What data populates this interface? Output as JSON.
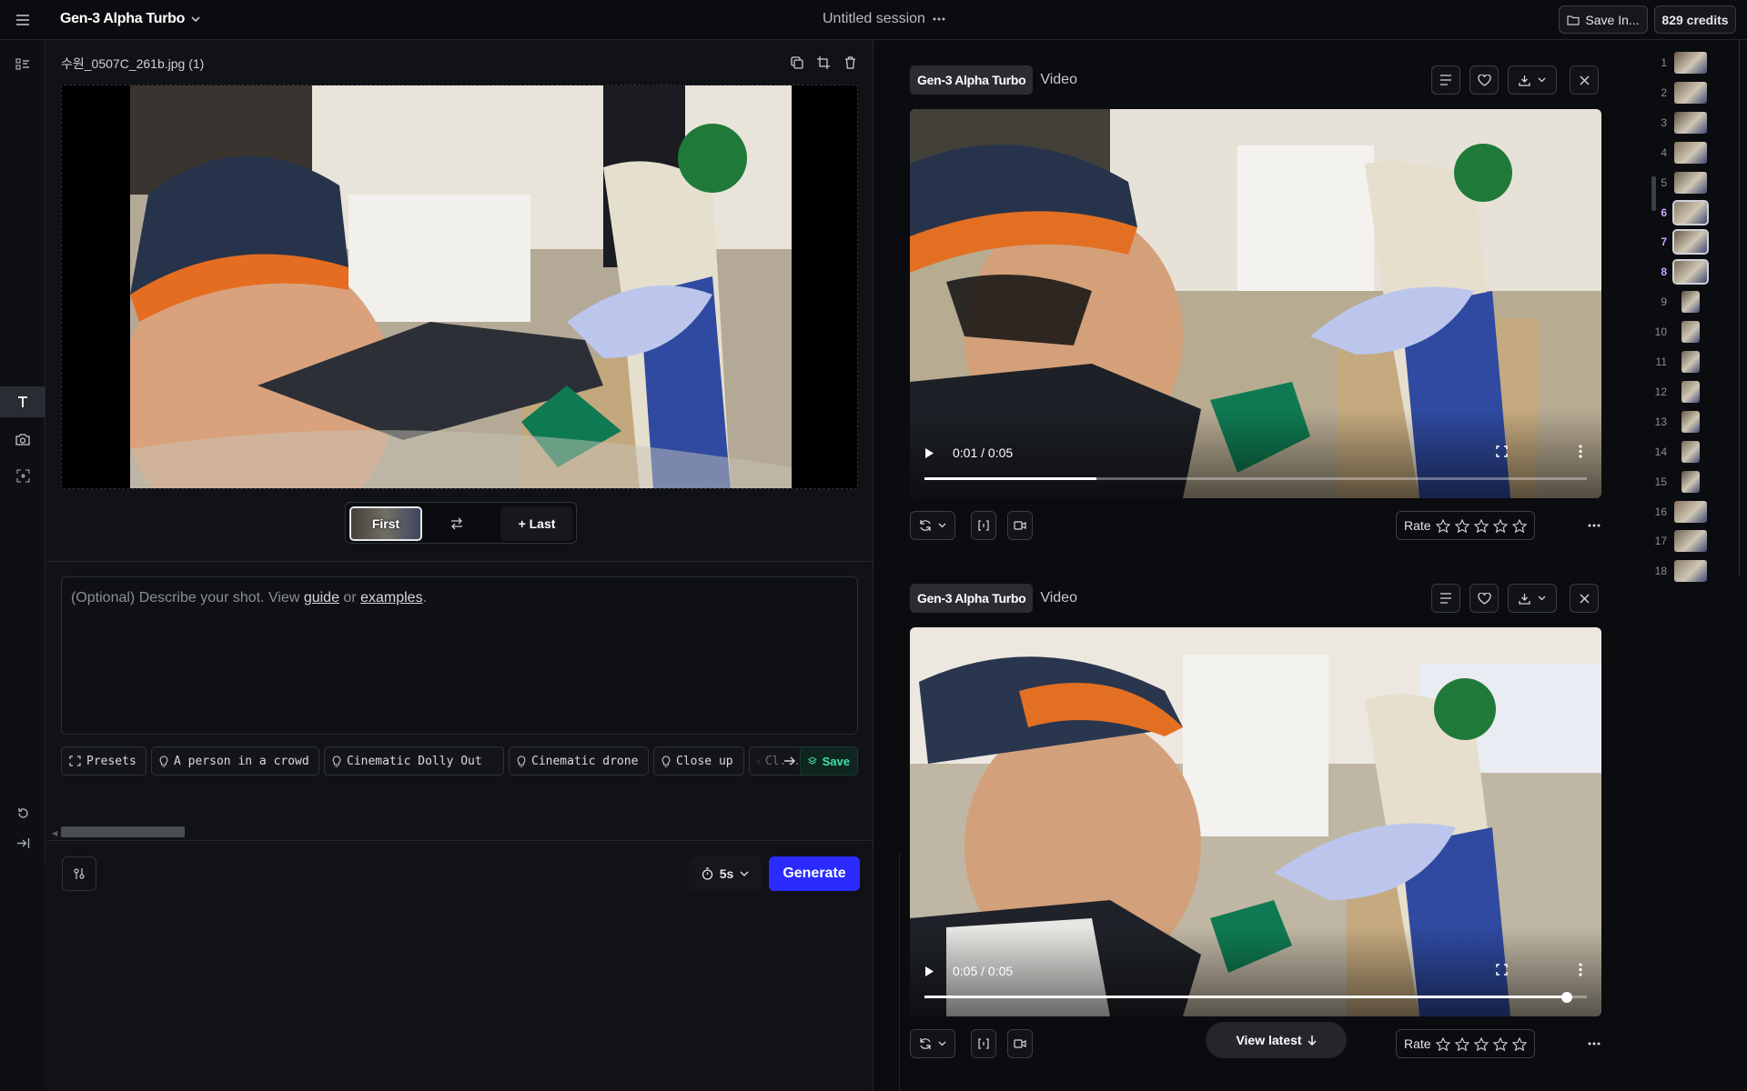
{
  "topbar": {
    "app_name": "Gen-3 Alpha Turbo",
    "session_title": "Untitled session",
    "save_label": "Save In...",
    "credits": "829 credits"
  },
  "left": {
    "file_name": "수원_0507C_261b.jpg (1)",
    "first_label": "First",
    "last_label": "+ Last",
    "prompt_placeholder_prefix": "(Optional) Describe your shot. View ",
    "prompt_link_guide": "guide",
    "prompt_or": " or ",
    "prompt_link_examples": "examples",
    "prompt_period": ".",
    "chips": [
      "Presets",
      "A person in a crowd",
      "Cinematic Dolly Out",
      "Cinematic drone",
      "Close up",
      "Cl..."
    ],
    "chip_save": "Save",
    "duration": "5s",
    "generate_label": "Generate"
  },
  "results": [
    {
      "model": "Gen-3 Alpha Turbo",
      "kind": "Video",
      "time": "0:01 / 0:05",
      "progress": 0.26,
      "rate_label": "Rate"
    },
    {
      "model": "Gen-3 Alpha Turbo",
      "kind": "Video",
      "time": "0:05 / 0:05",
      "progress": 0.97,
      "rate_label": "Rate"
    }
  ],
  "view_latest": "View latest",
  "strip": {
    "numbers": [
      "1",
      "2",
      "3",
      "4",
      "5",
      "6",
      "7",
      "8",
      "9",
      "10",
      "11",
      "12",
      "13",
      "14",
      "15",
      "16",
      "17",
      "18"
    ],
    "active": [
      "6",
      "7",
      "8"
    ]
  },
  "colors": {
    "accent": "#2b2bff",
    "save_green": "#3fe0a8",
    "active_purple": "#c9a8ff"
  }
}
